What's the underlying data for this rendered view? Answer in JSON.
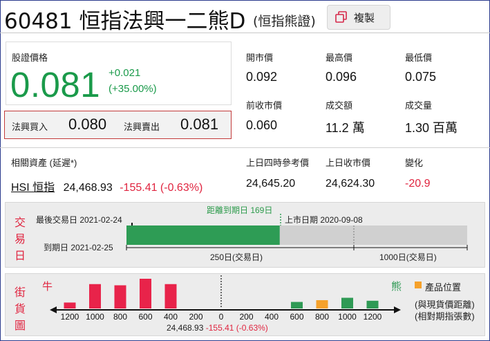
{
  "header": {
    "title": "60481 恒指法興一二熊D",
    "subtitle": "(恒指熊證)",
    "copy_label": "複製"
  },
  "price": {
    "label": "股證價格",
    "value": "0.081",
    "change": "+0.021",
    "change_pct": "(+35.00%)",
    "bid_label": "法興買入",
    "bid": "0.080",
    "ask_label": "法興賣出",
    "ask": "0.081"
  },
  "stats": {
    "open_label": "開市價",
    "open": "0.092",
    "high_label": "最高價",
    "high": "0.096",
    "low_label": "最低價",
    "low": "0.075",
    "prev_close_label": "前收市價",
    "prev_close": "0.060",
    "turnover_label": "成交額",
    "turnover": "11.2 萬",
    "volume_label": "成交量",
    "volume": "1.30 百萬"
  },
  "underlying": {
    "label": "相關資產 (延遲*)",
    "link": "HSI 恒指",
    "value": "24,468.93",
    "change": "-155.41 (-0.63%)",
    "ref4pm_label": "上日四時參考價",
    "ref4pm": "24,645.20",
    "prev_close_label": "上日收市價",
    "prev_close": "24,624.30",
    "change_label": "變化",
    "diff": "-20.9"
  },
  "trading_days": {
    "vertical_label": [
      "交",
      "易",
      "日"
    ],
    "last_trading_label": "最後交易日 2021-02-24",
    "expiry_label": "到期日 2021-02-25",
    "days_to_expiry": "距離到期日 169日",
    "listing_label": "上市日期 2020-09-08",
    "scale_250": "250日(交易日)",
    "scale_1000": "1000日(交易日)",
    "elapsed_fraction": 0.45
  },
  "street": {
    "vertical_label": [
      "街",
      "貨",
      "圖"
    ],
    "bull_label": "牛",
    "bear_label": "熊",
    "legend_label": "產品位置",
    "note1": "(與現貨價距離)",
    "note2": "(相對期指張數)",
    "spot": "24,468.93",
    "spot_change": "-155.41 (-0.63%)",
    "colors": {
      "bull": "#e8234a",
      "bear": "#2f9a55",
      "position": "#f5a12b"
    },
    "chart_data": {
      "type": "bar",
      "x_ticks": [
        "1200",
        "1000",
        "800",
        "600",
        "400",
        "200",
        "0",
        "200",
        "400",
        "600",
        "800",
        "1000",
        "1200"
      ],
      "bull_bars": [
        {
          "x": 1200,
          "value": 0.2
        },
        {
          "x": 1000,
          "value": 0.82
        },
        {
          "x": 800,
          "value": 0.78
        },
        {
          "x": 600,
          "value": 1.0
        },
        {
          "x": 400,
          "value": 0.82
        }
      ],
      "bear_bars": [
        {
          "x": 600,
          "value": 0.22
        },
        {
          "x": 800,
          "value": 0.28
        },
        {
          "x": 1000,
          "value": 0.36
        },
        {
          "x": 1200,
          "value": 0.26
        }
      ],
      "position_x": 800
    }
  }
}
